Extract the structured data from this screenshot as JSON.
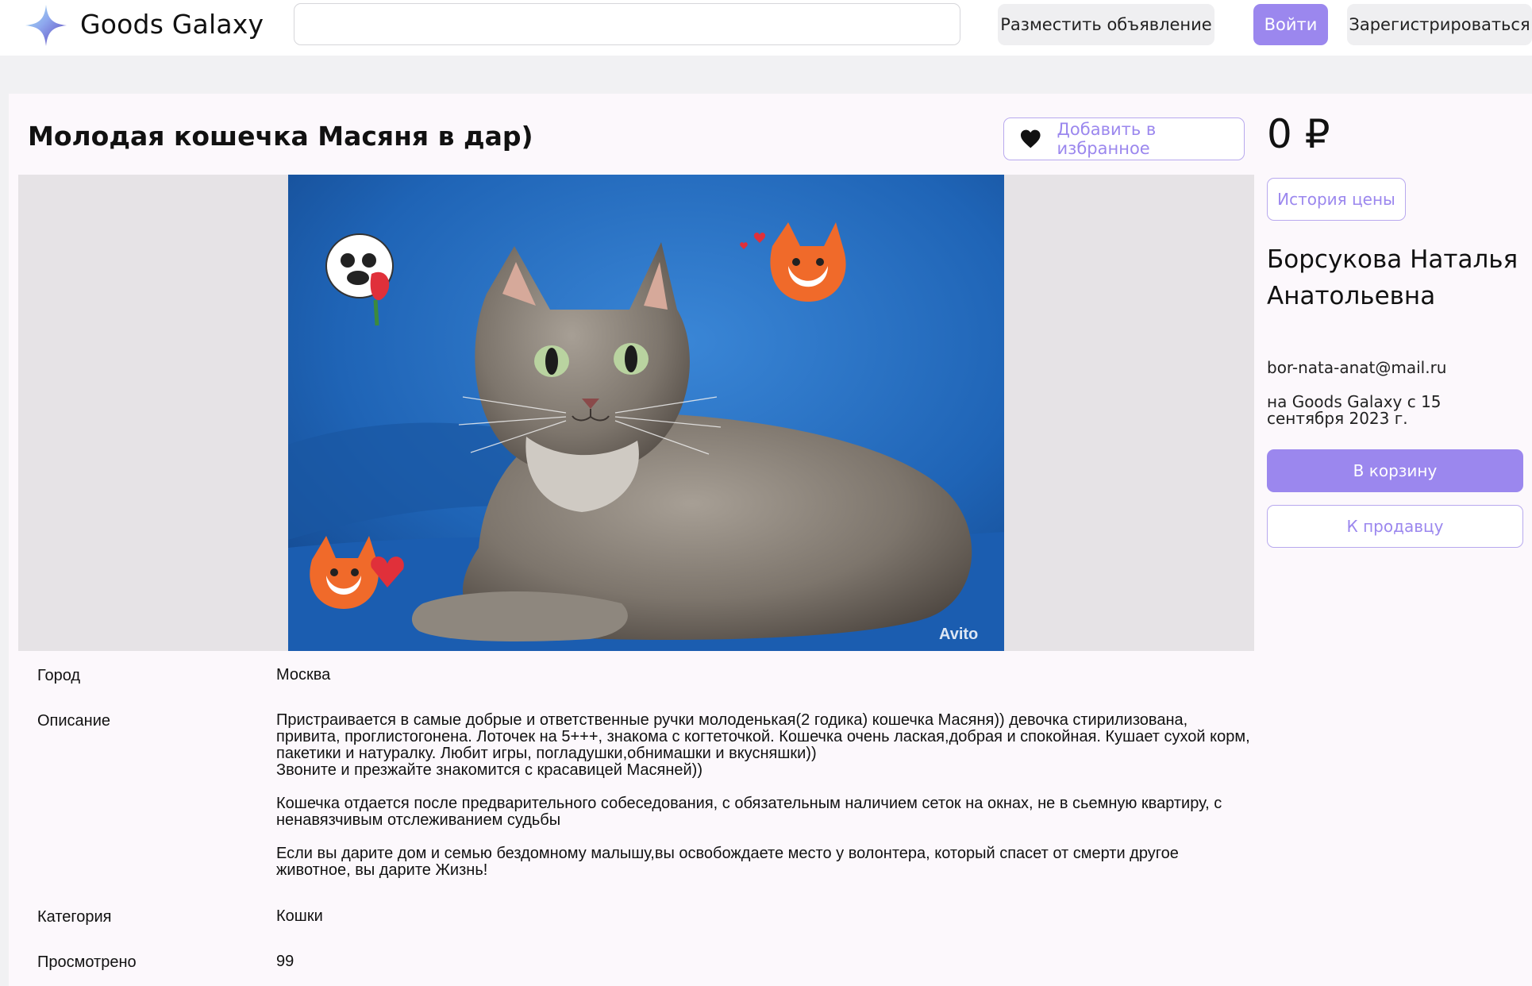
{
  "header": {
    "brand": "Goods Galaxy",
    "search_value": "",
    "search_placeholder": "",
    "post_ad_label": "Разместить объявление",
    "login_label": "Войти",
    "register_label": "Зарегистрироваться"
  },
  "listing": {
    "title": "Молодая кошечка Масяня в дар)",
    "favorite_label": "Добавить в избранное",
    "photo_watermark": "Avito",
    "price": "0 ₽",
    "price_history_label": "История цены",
    "details": [
      {
        "key": "Город",
        "value": "Москва"
      },
      {
        "key": "Описание",
        "paragraphs": [
          "Пристраивается в самые добрые и ответственные ручки молоденькая(2 годика) кошечка Масяня)) девочка стирилизована, привита, проглистогонена. Лоточек на 5+++, знакома с когтеточкой. Кошечка очень лаская,добрая и спокойная. Кушает сухой корм, пакетики и натуралку. Любит игры, погладушки,обнимашки и вкусняшки))\nЗвоните и презжайте знакомится с красавицей Масяней))",
          "Кошечка отдается после предварительного собеседования, с обязательным наличием сеток на окнах, не в сьемную квартиру, с ненавязчивым отслеживанием судьбы",
          "Если вы дарите дом и семью бездомному малышу,вы освобождаете место у волонтера, который спасет от смерти другое животное, вы дарите Жизнь!"
        ]
      },
      {
        "key": "Категория",
        "value": "Кошки"
      },
      {
        "key": "Просмотрено",
        "value": "99"
      }
    ]
  },
  "seller": {
    "name": "Борсукова Наталья Анатольевна",
    "email": "bor-nata-anat@mail.ru",
    "since": "на Goods Galaxy с 15 сентября 2023 г.",
    "cart_label": "В корзину",
    "to_seller_label": "К продавцу"
  },
  "colors": {
    "accent": "#9b87ee",
    "accent_border": "#b8a9ee",
    "photo_background": "#1f64b6"
  },
  "icons": {
    "logo": "four-point-star-logo",
    "favorite": "heart-icon"
  }
}
